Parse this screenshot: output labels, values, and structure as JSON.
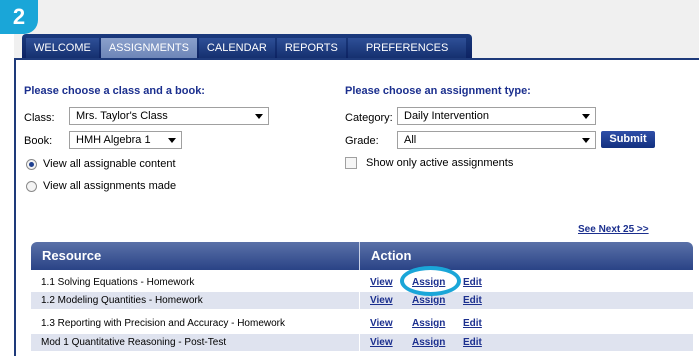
{
  "step_badge": "2",
  "nav": {
    "tabs": [
      {
        "label": "WELCOME",
        "active": false
      },
      {
        "label": "ASSIGNMENTS",
        "active": true
      },
      {
        "label": "CALENDAR",
        "active": false
      },
      {
        "label": "REPORTS",
        "active": false
      },
      {
        "label": "PREFERENCES",
        "active": false
      }
    ]
  },
  "class_book": {
    "title": "Please choose a class and a book:",
    "class_label": "Class:",
    "class_value": "Mrs. Taylor's Class",
    "book_label": "Book:",
    "book_value": "HMH Algebra 1",
    "radio_all_content": "View all assignable content",
    "radio_all_made": "View all assignments made"
  },
  "assignment_type": {
    "title": "Please choose an assignment type:",
    "category_label": "Category:",
    "category_value": "Daily Intervention",
    "grade_label": "Grade:",
    "grade_value": "All",
    "submit_label": "Submit",
    "active_only_label": "Show only active assignments"
  },
  "see_next": "See Next 25 >>",
  "table": {
    "col_resource": "Resource",
    "col_action": "Action",
    "action_view": "View",
    "action_assign": "Assign",
    "action_edit": "Edit",
    "rows": [
      "1.1 Solving Equations - Homework",
      "1.2 Modeling Quantities - Homework",
      "1.3 Reporting with Precision and Accuracy - Homework",
      "Mod 1 Quantitative Reasoning - Post-Test"
    ]
  },
  "colors": {
    "nav_blue": "#0d2363",
    "link_blue": "#1b2f8e",
    "highlight_cyan": "#1aa6d8"
  }
}
